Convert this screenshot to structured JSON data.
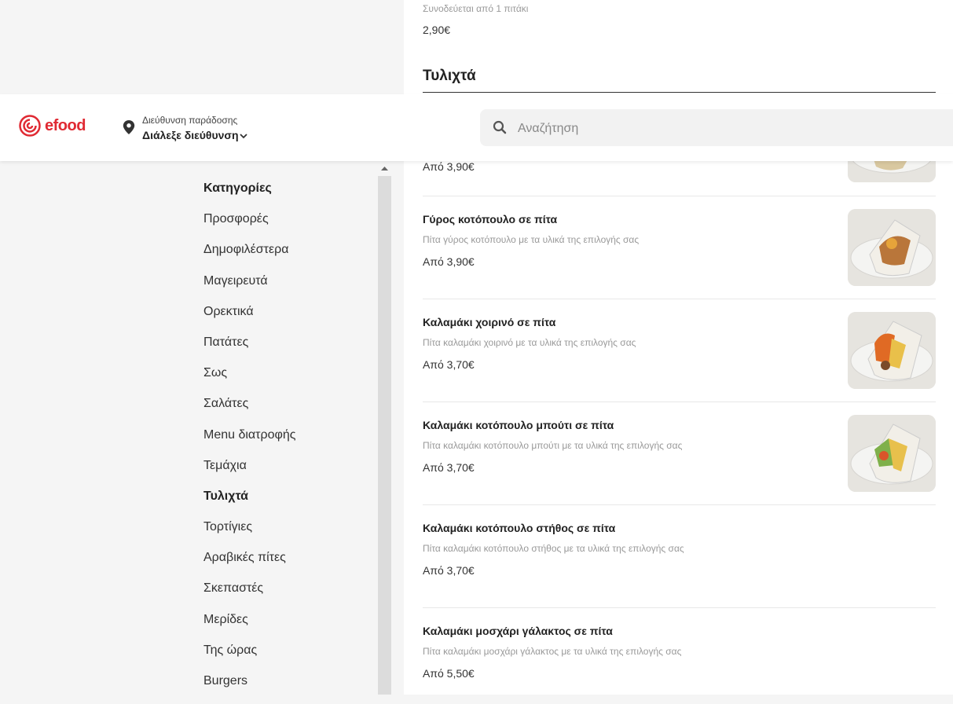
{
  "header": {
    "brand": "efood",
    "address_label": "Διεύθυνση παράδοσης",
    "address_value": "Διάλεξε διεύθυνση",
    "search_placeholder": "Αναζήτηση"
  },
  "sidebar": {
    "heading": "Κατηγορίες",
    "items": [
      "Προσφορές",
      "Δημοφιλέστερα",
      "Μαγειρευτά",
      "Ορεκτικά",
      "Πατάτες",
      "Σως",
      "Σαλάτες",
      "Menu διατροφής",
      "Τεμάχια",
      "Τυλιχτά",
      "Τορτίγιες",
      "Αραβικές πίτες",
      "Σκεπαστές",
      "Μερίδες",
      "Της ώρας",
      "Burgers"
    ],
    "active": "Τυλιχτά"
  },
  "menu": {
    "prev_item_desc": "Συνοδεύεται από 1 πιτάκι",
    "prev_item_price": "2,90€",
    "section_title": "Τυλιχτά",
    "first_price": "Από 3,90€",
    "items": [
      {
        "name": "Γύρος κοτόπουλο σε πίτα",
        "desc": "Πίτα γύρος κοτόπουλο με τα υλικά της επιλογής σας",
        "price": "Από 3,90€",
        "image": true
      },
      {
        "name": "Καλαμάκι χοιρινό σε πίτα",
        "desc": "Πίτα καλαμάκι χοιρινό με τα υλικά της επιλογής σας",
        "price": "Από 3,70€",
        "image": true
      },
      {
        "name": "Καλαμάκι κοτόπουλο μπούτι σε πίτα",
        "desc": "Πίτα καλαμάκι κοτόπουλο μπούτι με τα υλικά της επιλογής σας",
        "price": "Από 3,70€",
        "image": true
      },
      {
        "name": "Καλαμάκι κοτόπουλο στήθος σε πίτα",
        "desc": "Πίτα καλαμάκι κοτόπουλο στήθος με τα υλικά της επιλογής σας",
        "price": "Από 3,70€",
        "image": false
      },
      {
        "name": "Καλαμάκι μοσχάρι γάλακτος σε πίτα",
        "desc": "Πίτα καλαμάκι μοσχάρι γάλακτος με τα υλικά της επιλογής σας",
        "price": "Από 5,50€",
        "image": false
      }
    ]
  },
  "colors": {
    "brand": "#e02a33"
  }
}
